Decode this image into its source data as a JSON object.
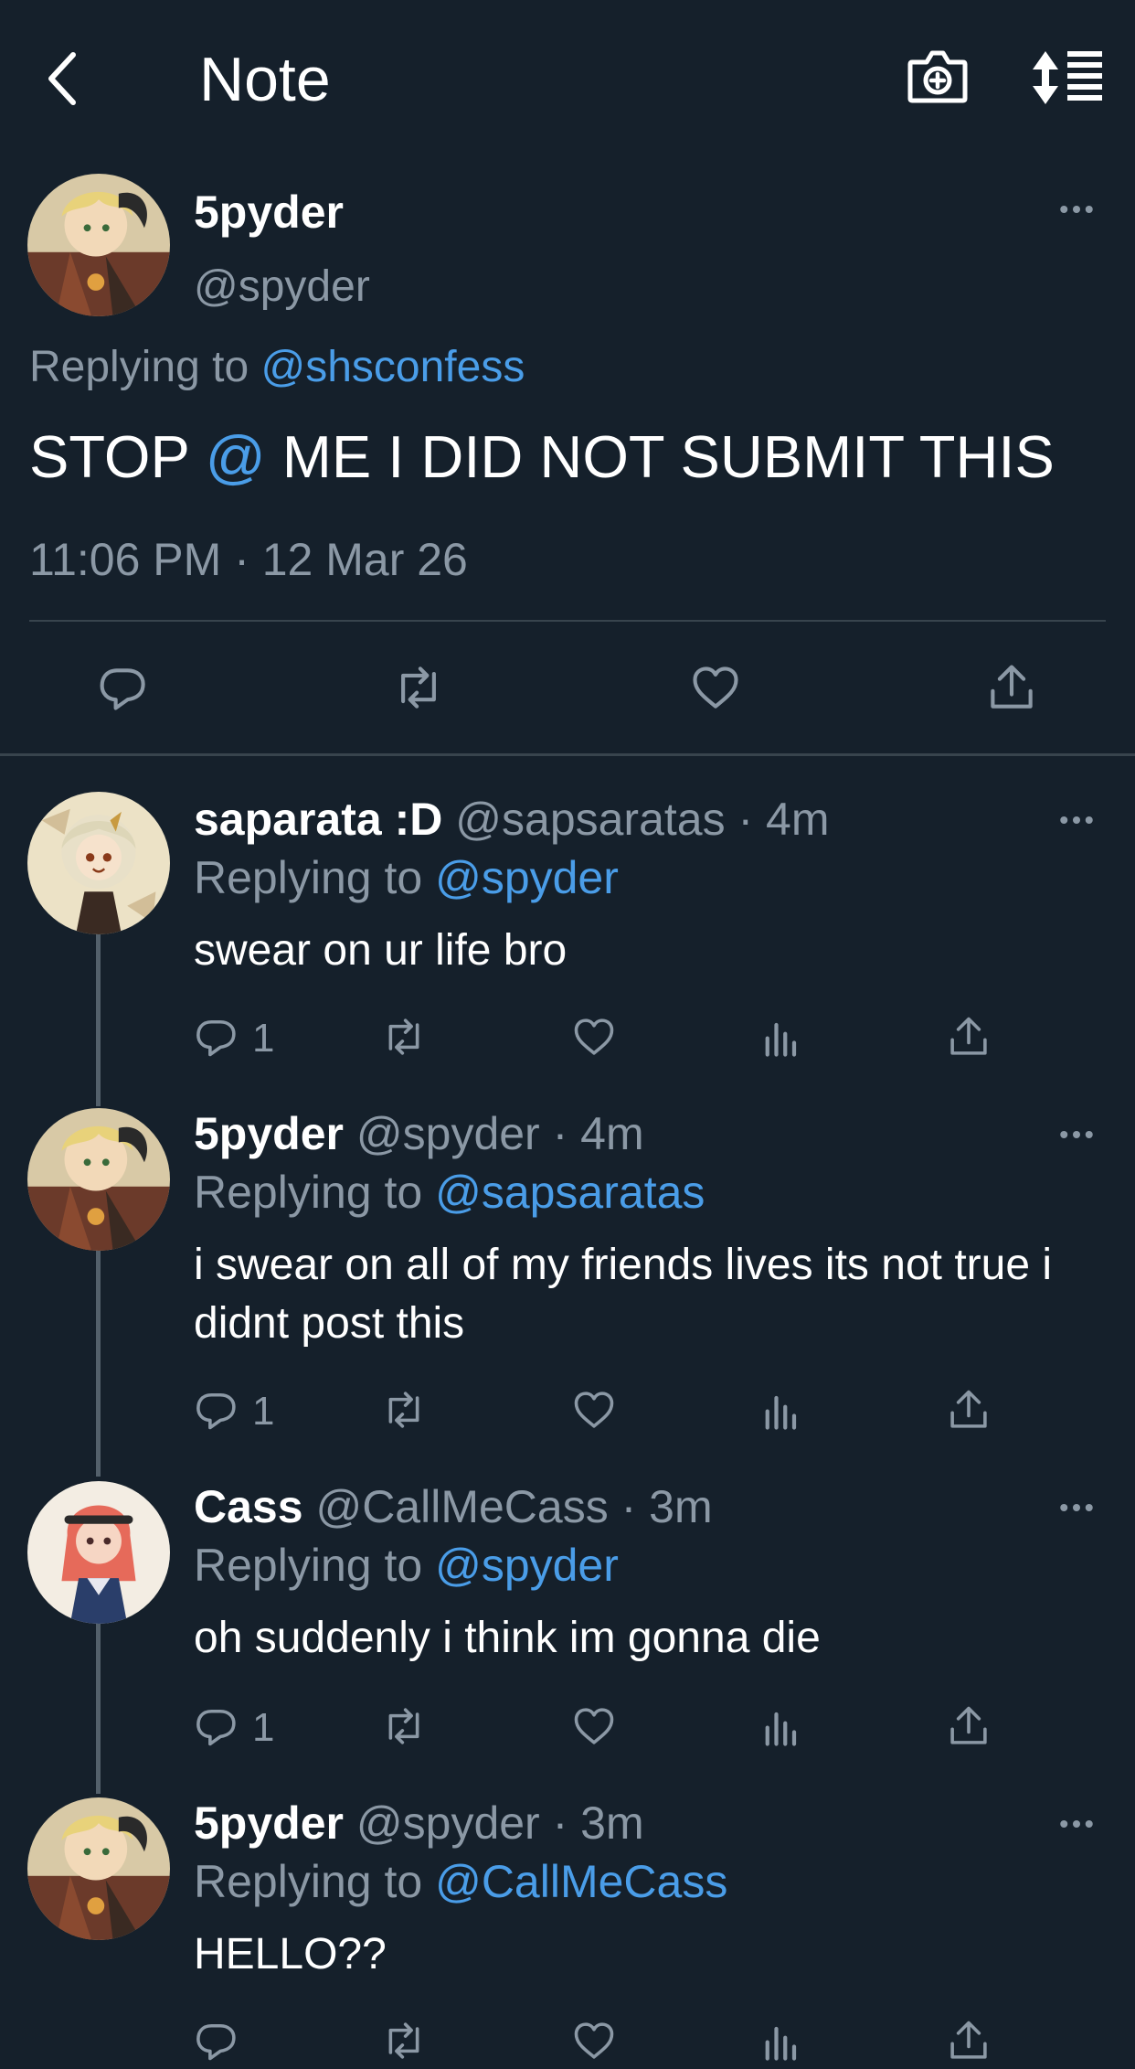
{
  "header": {
    "title": "Note",
    "back_icon": "chevron-left-icon",
    "camera_icon": "camera-plus-icon",
    "sort_icon": "sort-list-icon"
  },
  "main_tweet": {
    "name": "5pyder",
    "handle": "@spyder",
    "replying_prefix": "Replying to",
    "replying_to": "@shsconfess",
    "text_before": "STOP",
    "text_mention": "@",
    "text_after": "ME I DID NOT SUBMIT THIS",
    "timestamp": "11:06 PM · 12 Mar 26"
  },
  "replies": [
    {
      "name": "saparata :D",
      "handle": "@sapsaratas",
      "time": "· 4m",
      "replying_prefix": "Replying to",
      "replying_to": "@spyder",
      "text": "swear on ur life bro",
      "reply_count": "1"
    },
    {
      "name": "5pyder",
      "handle": "@spyder",
      "time": "· 4m",
      "replying_prefix": "Replying to",
      "replying_to": "@sapsaratas",
      "text": "i swear on all of my friends lives its not true i didnt post this",
      "reply_count": "1"
    },
    {
      "name": "Cass",
      "handle": "@CallMeCass",
      "time": "· 3m",
      "replying_prefix": "Replying to",
      "replying_to": "@spyder",
      "text": "oh suddenly i think im gonna die",
      "reply_count": "1"
    },
    {
      "name": "5pyder",
      "handle": "@spyder",
      "time": "· 3m",
      "replying_prefix": "Replying to",
      "replying_to": "@CallMeCass",
      "text": "HELLO??",
      "reply_count": ""
    }
  ],
  "colors": {
    "background": "#15202b",
    "link": "#4a9de8",
    "muted": "#8b98a5",
    "divider": "#38444d"
  }
}
